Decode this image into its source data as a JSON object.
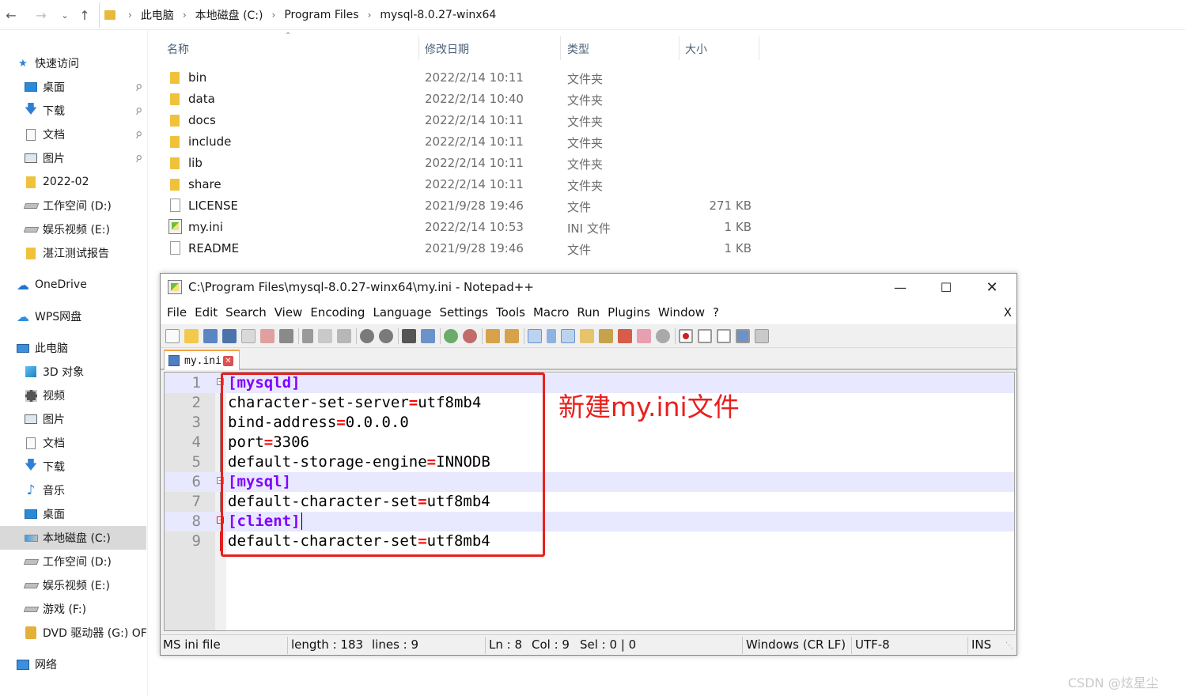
{
  "address_bar": {
    "crumbs": [
      "此电脑",
      "本地磁盘 (C:)",
      "Program Files",
      "mysql-8.0.27-winx64"
    ]
  },
  "nav_pane": {
    "quick_access": "快速访问",
    "items": [
      {
        "label": "桌面",
        "pinned": true
      },
      {
        "label": "下载",
        "pinned": true
      },
      {
        "label": "文档",
        "pinned": true
      },
      {
        "label": "图片",
        "pinned": true
      },
      {
        "label": "2022-02"
      },
      {
        "label": "工作空间 (D:)"
      },
      {
        "label": "娱乐视频 (E:)"
      },
      {
        "label": "湛江测试报告"
      }
    ],
    "onedrive": "OneDrive",
    "wps": "WPS网盘",
    "this_pc": "此电脑",
    "pc_items": [
      {
        "label": "3D 对象"
      },
      {
        "label": "视频"
      },
      {
        "label": "图片"
      },
      {
        "label": "文档"
      },
      {
        "label": "下载"
      },
      {
        "label": "音乐"
      },
      {
        "label": "桌面"
      },
      {
        "label": "本地磁盘 (C:)",
        "selected": true
      },
      {
        "label": "工作空间 (D:)"
      },
      {
        "label": "娱乐视频 (E:)"
      },
      {
        "label": "游戏 (F:)"
      },
      {
        "label": "DVD 驱动器 (G:) OF"
      }
    ],
    "network": "网络"
  },
  "file_list": {
    "columns": {
      "name": "名称",
      "date": "修改日期",
      "type": "类型",
      "size": "大小"
    },
    "rows": [
      {
        "name": "bin",
        "date": "2022/2/14 10:11",
        "type": "文件夹",
        "size": "",
        "kind": "folder"
      },
      {
        "name": "data",
        "date": "2022/2/14 10:40",
        "type": "文件夹",
        "size": "",
        "kind": "folder"
      },
      {
        "name": "docs",
        "date": "2022/2/14 10:11",
        "type": "文件夹",
        "size": "",
        "kind": "folder"
      },
      {
        "name": "include",
        "date": "2022/2/14 10:11",
        "type": "文件夹",
        "size": "",
        "kind": "folder"
      },
      {
        "name": "lib",
        "date": "2022/2/14 10:11",
        "type": "文件夹",
        "size": "",
        "kind": "folder"
      },
      {
        "name": "share",
        "date": "2022/2/14 10:11",
        "type": "文件夹",
        "size": "",
        "kind": "folder"
      },
      {
        "name": "LICENSE",
        "date": "2021/9/28 19:46",
        "type": "文件",
        "size": "271 KB",
        "kind": "file"
      },
      {
        "name": "my.ini",
        "date": "2022/2/14 10:53",
        "type": "INI 文件",
        "size": "1 KB",
        "kind": "ini"
      },
      {
        "name": "README",
        "date": "2021/9/28 19:46",
        "type": "文件",
        "size": "1 KB",
        "kind": "file"
      }
    ]
  },
  "notepad": {
    "title": "C:\\Program Files\\mysql-8.0.27-winx64\\my.ini - Notepad++",
    "menu": [
      "File",
      "Edit",
      "Search",
      "View",
      "Encoding",
      "Language",
      "Settings",
      "Tools",
      "Macro",
      "Run",
      "Plugins",
      "Window",
      "?"
    ],
    "menu_close": "X",
    "tab_label": "my.ini",
    "lines": [
      {
        "num": "1",
        "section": "[mysqld]"
      },
      {
        "num": "2",
        "key": "character-set-server",
        "eq": "=",
        "value": "utf8mb4"
      },
      {
        "num": "3",
        "key": "bind-address",
        "eq": "=",
        "value": "0.0.0.0"
      },
      {
        "num": "4",
        "key": "port",
        "eq": "=",
        "value": "3306"
      },
      {
        "num": "5",
        "key": "default-storage-engine",
        "eq": "=",
        "value": "INNODB"
      },
      {
        "num": "6",
        "section": "[mysql]"
      },
      {
        "num": "7",
        "key": "default-character-set",
        "eq": "=",
        "value": "utf8mb4"
      },
      {
        "num": "8",
        "section": "[client]"
      },
      {
        "num": "9",
        "key": "default-character-set",
        "eq": "=",
        "value": "utf8mb4"
      }
    ],
    "status": {
      "file_type": "MS ini file",
      "length": "length : 183",
      "lines": "lines : 9",
      "ln": "Ln : 8",
      "col": "Col : 9",
      "sel": "Sel : 0 | 0",
      "eol": "Windows (CR LF)",
      "encoding": "UTF-8",
      "mode": "INS"
    }
  },
  "annotation": {
    "text": "新建my.ini文件",
    "color": "#e8201c"
  },
  "watermark": "CSDN @炫星尘"
}
